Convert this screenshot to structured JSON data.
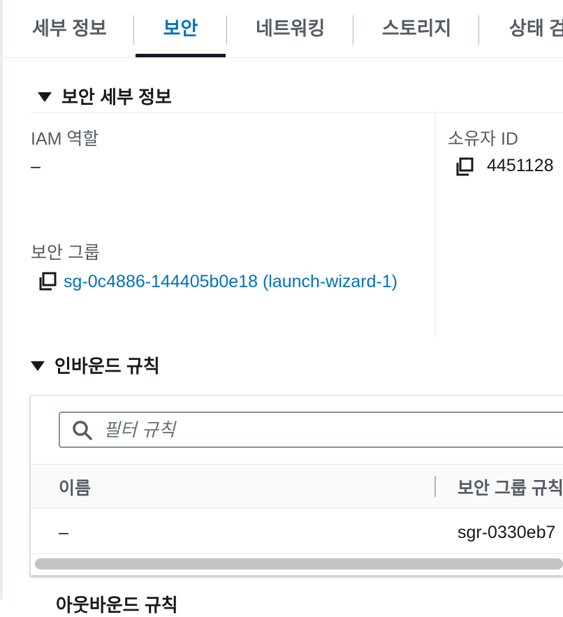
{
  "tabs": [
    {
      "label": "세부 정보",
      "active": false
    },
    {
      "label": "보안",
      "active": true
    },
    {
      "label": "네트워킹",
      "active": false
    },
    {
      "label": "스토리지",
      "active": false
    },
    {
      "label": "상태 검사",
      "active": false
    }
  ],
  "security_details": {
    "heading": "보안 세부 정보",
    "iam_role_label": "IAM 역할",
    "iam_role_value": "–",
    "owner_id_label": "소유자 ID",
    "owner_id_value": "4451128",
    "security_groups_label": "보안 그룹",
    "security_group_link": "sg-0c4886-144405b0e18 (launch-wizard-1)"
  },
  "inbound_rules": {
    "heading": "인바운드 규칙",
    "search_placeholder": "필터 규칙",
    "columns": [
      "이름",
      "보안 그룹 규칙"
    ],
    "rows": [
      {
        "name": "–",
        "rule_id": "sgr-0330eb7"
      }
    ]
  },
  "outbound_rules": {
    "heading": "아웃바운드 규칙"
  },
  "colors": {
    "accent": "#0073bb",
    "active_underline": "#16191f",
    "text": "#16191f",
    "muted": "#545b64"
  }
}
